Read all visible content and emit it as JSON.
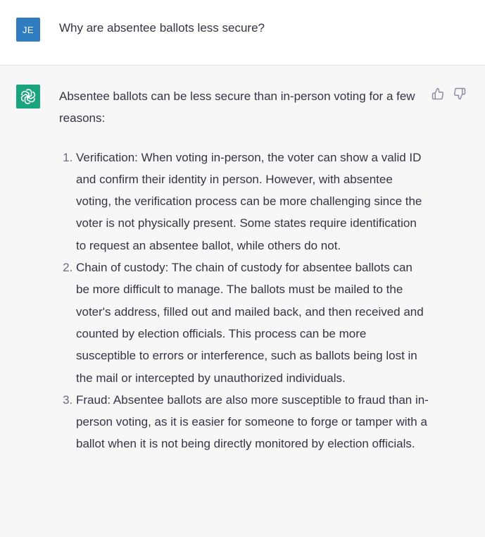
{
  "user_message": {
    "avatar_initials": "JE",
    "text": "Why are absentee ballots less secure?"
  },
  "assistant_message": {
    "intro": "Absentee ballots can be less secure than in-person voting for a few reasons:",
    "points": [
      "Verification: When voting in-person, the voter can show a valid ID and confirm their identity in person. However, with absentee voting, the verification process can be more challenging since the voter is not physically present. Some states require identification to request an absentee ballot, while others do not.",
      "Chain of custody: The chain of custody for absentee ballots can be more difficult to manage. The ballots must be mailed to the voter's address, filled out and mailed back, and then received and counted by election officials. This process can be more susceptible to errors or interference, such as ballots being lost in the mail or intercepted by unauthorized individuals.",
      "Fraud: Absentee ballots are also more susceptible to fraud than in-person voting, as it is easier for someone to forge or tamper with a ballot when it is not being directly monitored by election officials."
    ]
  },
  "icons": {
    "assistant_avatar": "openai-logo-icon",
    "feedback_up": "thumbs-up-icon",
    "feedback_down": "thumbs-down-icon"
  },
  "colors": {
    "user_avatar_bg": "#2f7cc1",
    "assistant_avatar_bg": "#19a37f",
    "assistant_row_bg": "#f7f7f8",
    "text": "#343541"
  }
}
